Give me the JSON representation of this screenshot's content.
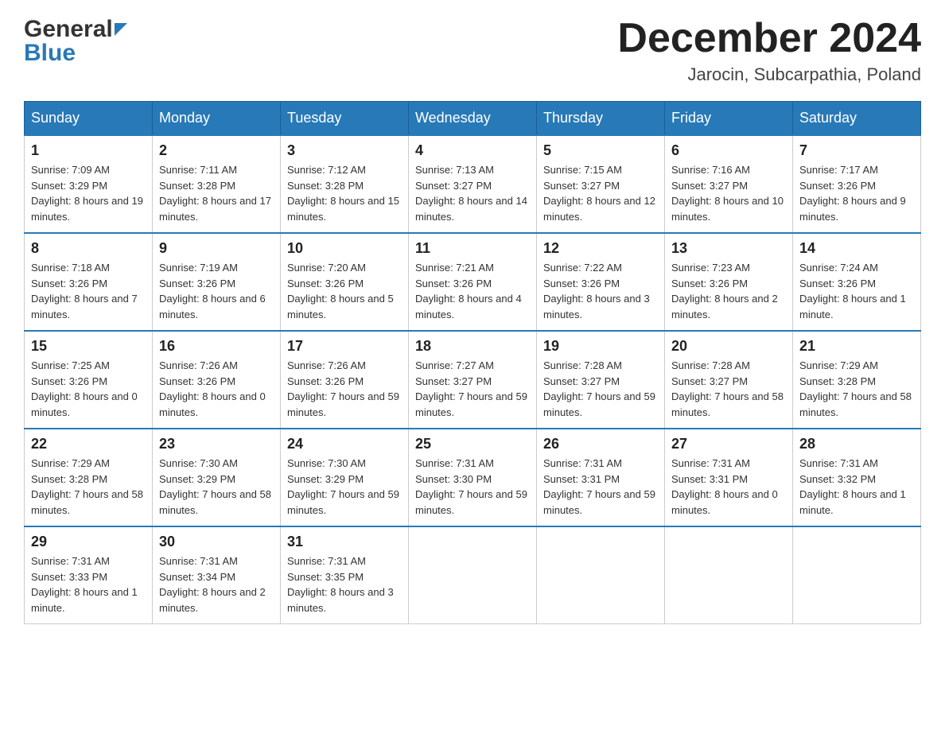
{
  "header": {
    "logo_line1": "General",
    "logo_line2": "Blue",
    "month_title": "December 2024",
    "location": "Jarocin, Subcarpathia, Poland"
  },
  "days_of_week": [
    "Sunday",
    "Monday",
    "Tuesday",
    "Wednesday",
    "Thursday",
    "Friday",
    "Saturday"
  ],
  "weeks": [
    [
      {
        "day": "1",
        "sunrise": "7:09 AM",
        "sunset": "3:29 PM",
        "daylight": "8 hours and 19 minutes."
      },
      {
        "day": "2",
        "sunrise": "7:11 AM",
        "sunset": "3:28 PM",
        "daylight": "8 hours and 17 minutes."
      },
      {
        "day": "3",
        "sunrise": "7:12 AM",
        "sunset": "3:28 PM",
        "daylight": "8 hours and 15 minutes."
      },
      {
        "day": "4",
        "sunrise": "7:13 AM",
        "sunset": "3:27 PM",
        "daylight": "8 hours and 14 minutes."
      },
      {
        "day": "5",
        "sunrise": "7:15 AM",
        "sunset": "3:27 PM",
        "daylight": "8 hours and 12 minutes."
      },
      {
        "day": "6",
        "sunrise": "7:16 AM",
        "sunset": "3:27 PM",
        "daylight": "8 hours and 10 minutes."
      },
      {
        "day": "7",
        "sunrise": "7:17 AM",
        "sunset": "3:26 PM",
        "daylight": "8 hours and 9 minutes."
      }
    ],
    [
      {
        "day": "8",
        "sunrise": "7:18 AM",
        "sunset": "3:26 PM",
        "daylight": "8 hours and 7 minutes."
      },
      {
        "day": "9",
        "sunrise": "7:19 AM",
        "sunset": "3:26 PM",
        "daylight": "8 hours and 6 minutes."
      },
      {
        "day": "10",
        "sunrise": "7:20 AM",
        "sunset": "3:26 PM",
        "daylight": "8 hours and 5 minutes."
      },
      {
        "day": "11",
        "sunrise": "7:21 AM",
        "sunset": "3:26 PM",
        "daylight": "8 hours and 4 minutes."
      },
      {
        "day": "12",
        "sunrise": "7:22 AM",
        "sunset": "3:26 PM",
        "daylight": "8 hours and 3 minutes."
      },
      {
        "day": "13",
        "sunrise": "7:23 AM",
        "sunset": "3:26 PM",
        "daylight": "8 hours and 2 minutes."
      },
      {
        "day": "14",
        "sunrise": "7:24 AM",
        "sunset": "3:26 PM",
        "daylight": "8 hours and 1 minute."
      }
    ],
    [
      {
        "day": "15",
        "sunrise": "7:25 AM",
        "sunset": "3:26 PM",
        "daylight": "8 hours and 0 minutes."
      },
      {
        "day": "16",
        "sunrise": "7:26 AM",
        "sunset": "3:26 PM",
        "daylight": "8 hours and 0 minutes."
      },
      {
        "day": "17",
        "sunrise": "7:26 AM",
        "sunset": "3:26 PM",
        "daylight": "7 hours and 59 minutes."
      },
      {
        "day": "18",
        "sunrise": "7:27 AM",
        "sunset": "3:27 PM",
        "daylight": "7 hours and 59 minutes."
      },
      {
        "day": "19",
        "sunrise": "7:28 AM",
        "sunset": "3:27 PM",
        "daylight": "7 hours and 59 minutes."
      },
      {
        "day": "20",
        "sunrise": "7:28 AM",
        "sunset": "3:27 PM",
        "daylight": "7 hours and 58 minutes."
      },
      {
        "day": "21",
        "sunrise": "7:29 AM",
        "sunset": "3:28 PM",
        "daylight": "7 hours and 58 minutes."
      }
    ],
    [
      {
        "day": "22",
        "sunrise": "7:29 AM",
        "sunset": "3:28 PM",
        "daylight": "7 hours and 58 minutes."
      },
      {
        "day": "23",
        "sunrise": "7:30 AM",
        "sunset": "3:29 PM",
        "daylight": "7 hours and 58 minutes."
      },
      {
        "day": "24",
        "sunrise": "7:30 AM",
        "sunset": "3:29 PM",
        "daylight": "7 hours and 59 minutes."
      },
      {
        "day": "25",
        "sunrise": "7:31 AM",
        "sunset": "3:30 PM",
        "daylight": "7 hours and 59 minutes."
      },
      {
        "day": "26",
        "sunrise": "7:31 AM",
        "sunset": "3:31 PM",
        "daylight": "7 hours and 59 minutes."
      },
      {
        "day": "27",
        "sunrise": "7:31 AM",
        "sunset": "3:31 PM",
        "daylight": "8 hours and 0 minutes."
      },
      {
        "day": "28",
        "sunrise": "7:31 AM",
        "sunset": "3:32 PM",
        "daylight": "8 hours and 1 minute."
      }
    ],
    [
      {
        "day": "29",
        "sunrise": "7:31 AM",
        "sunset": "3:33 PM",
        "daylight": "8 hours and 1 minute."
      },
      {
        "day": "30",
        "sunrise": "7:31 AM",
        "sunset": "3:34 PM",
        "daylight": "8 hours and 2 minutes."
      },
      {
        "day": "31",
        "sunrise": "7:31 AM",
        "sunset": "3:35 PM",
        "daylight": "8 hours and 3 minutes."
      },
      null,
      null,
      null,
      null
    ]
  ],
  "labels": {
    "sunrise": "Sunrise:",
    "sunset": "Sunset:",
    "daylight": "Daylight:"
  }
}
